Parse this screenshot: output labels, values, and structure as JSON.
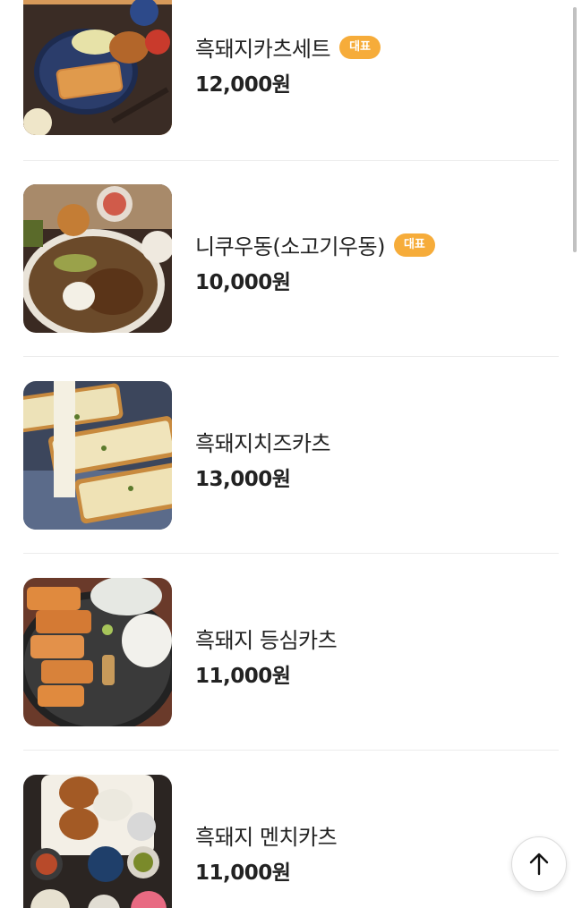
{
  "menu": {
    "items": [
      {
        "name": "흑돼지카츠세트",
        "price": "12,000원",
        "badge": "대표",
        "image": "tonkatsu-set-photo"
      },
      {
        "name": "니쿠우동(소고기우동)",
        "price": "10,000원",
        "badge": "대표",
        "image": "beef-udon-photo"
      },
      {
        "name": "흑돼지치즈카츠",
        "price": "13,000원",
        "badge": "",
        "image": "cheese-katsu-photo"
      },
      {
        "name": "흑돼지 등심카츠",
        "price": "11,000원",
        "badge": "",
        "image": "loin-katsu-photo"
      },
      {
        "name": "흑돼지 멘치카츠",
        "price": "11,000원",
        "badge": "",
        "image": "menchi-katsu-photo"
      }
    ]
  },
  "scroll_top_button": {
    "icon": "arrow-up-icon"
  },
  "colors": {
    "badge": "#f6ac3a",
    "divider": "#ececec",
    "text": "#222222"
  }
}
